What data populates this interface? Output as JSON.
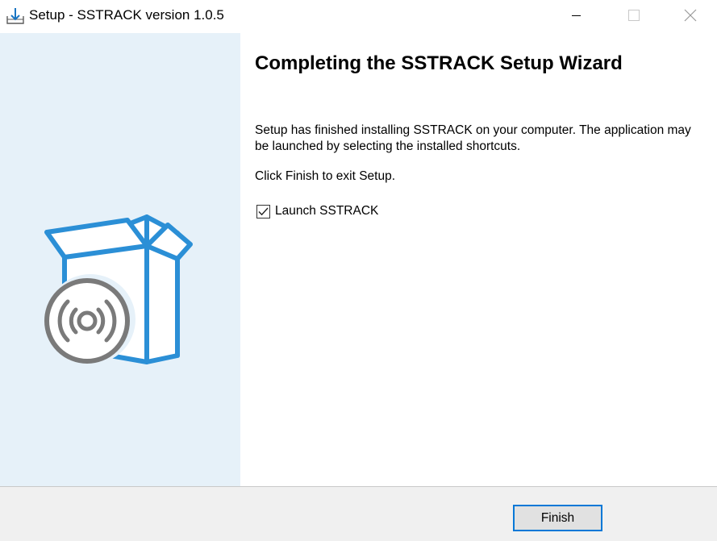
{
  "window": {
    "title": "Setup - SSTRACK version 1.0.5",
    "icons": {
      "app": "installer-download-icon",
      "minimize": "minimize-icon",
      "maximize": "maximize-icon",
      "close": "close-icon"
    }
  },
  "sidebar": {
    "illustration": "software-box-with-disc-icon",
    "colors": {
      "background": "#e6f1f9",
      "box_stroke": "#2b8fd6",
      "disc": "#7a7a7a"
    }
  },
  "main": {
    "heading": "Completing the SSTRACK Setup Wizard",
    "paragraph1": "Setup has finished installing SSTRACK on your computer. The application may be launched by selecting the installed shortcuts.",
    "paragraph2": "Click Finish to exit Setup.",
    "launch_checkbox": {
      "label": "Launch SSTRACK",
      "checked": true
    }
  },
  "footer": {
    "finish_label": "Finish",
    "colors": {
      "focus_border": "#0078d7",
      "button_bg": "#e1e1e1"
    }
  }
}
